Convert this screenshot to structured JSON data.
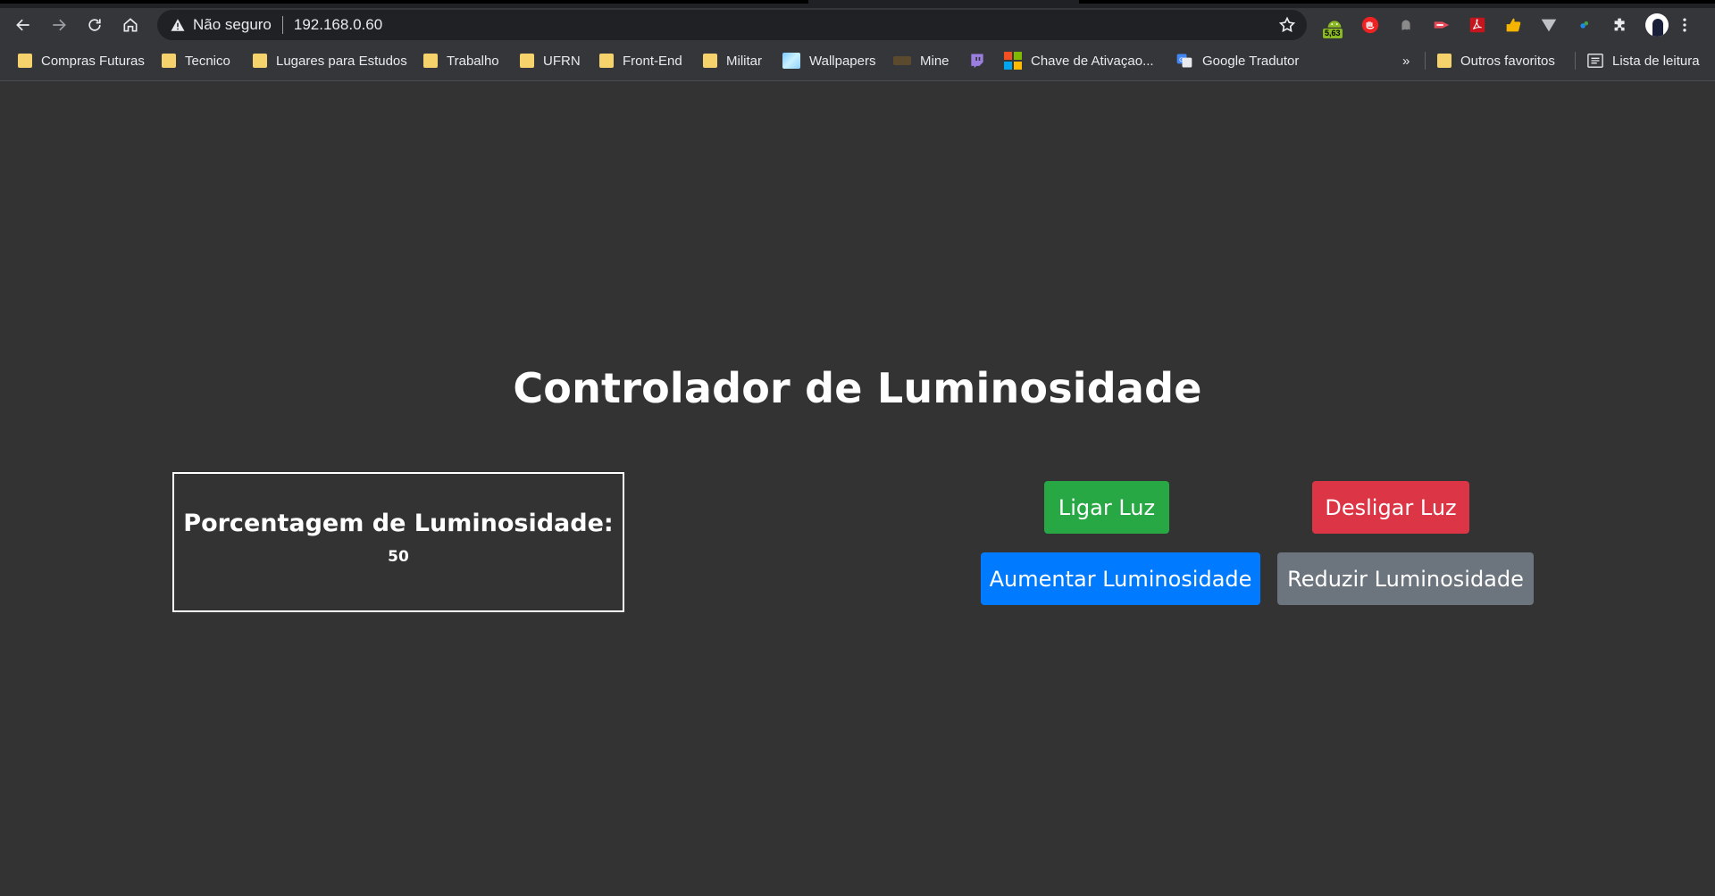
{
  "browser": {
    "security_label": "Não seguro",
    "url": "192.168.0.60",
    "extensions": [
      {
        "name": "android-icon",
        "badge": "5,63"
      },
      {
        "name": "adblock-icon"
      },
      {
        "name": "ghost-icon"
      },
      {
        "name": "cast-icon"
      },
      {
        "name": "pdf-icon"
      },
      {
        "name": "thumbs-up-icon"
      },
      {
        "name": "vpn-icon"
      },
      {
        "name": "dot-icon"
      },
      {
        "name": "puzzle-icon"
      }
    ]
  },
  "bookmarks": {
    "items": [
      {
        "label": "Compras Futuras",
        "icon": "folder-icon"
      },
      {
        "label": "Tecnico",
        "icon": "folder-icon"
      },
      {
        "label": "Lugares para Estudos",
        "icon": "folder-icon"
      },
      {
        "label": "Trabalho",
        "icon": "folder-icon"
      },
      {
        "label": "UFRN",
        "icon": "folder-icon"
      },
      {
        "label": "Front-End",
        "icon": "folder-icon"
      },
      {
        "label": "Militar",
        "icon": "folder-icon"
      },
      {
        "label": "Wallpapers",
        "icon": "wallpaper-icon"
      },
      {
        "label": "Mine",
        "icon": "minecraft-icon"
      },
      {
        "label": "",
        "icon": "twitch-icon"
      },
      {
        "label": "Chave de Ativaçao...",
        "icon": "microsoft-icon"
      },
      {
        "label": "Google Tradutor",
        "icon": "translate-icon"
      }
    ],
    "overflow": "»",
    "other_favorites": "Outros favoritos",
    "reading_list": "Lista de leitura"
  },
  "page": {
    "title": "Controlador de Luminosidade",
    "luminosity_label": "Porcentagem de Luminosidade:",
    "luminosity_value": "50",
    "buttons": {
      "on": "Ligar Luz",
      "off": "Desligar Luz",
      "increase": "Aumentar Luminosidade",
      "decrease": "Reduzir Luminosidade"
    }
  },
  "colors": {
    "background": "#333333",
    "on": "#28a745",
    "off": "#dc3545",
    "increase": "#007bff",
    "decrease": "#6c757d"
  }
}
